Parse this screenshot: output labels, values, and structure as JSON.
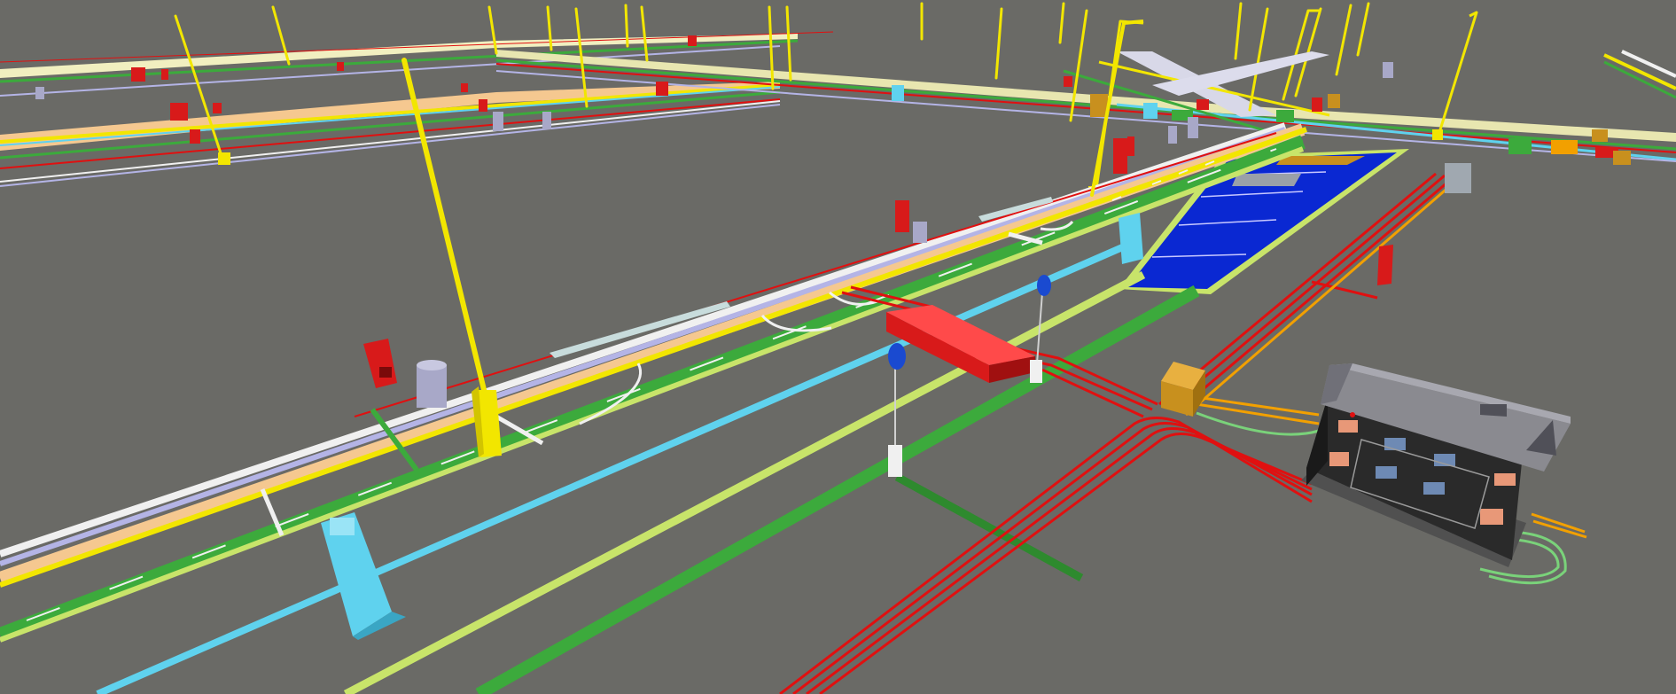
{
  "scene": {
    "background": "#6a6a66",
    "colors": {
      "street_light": "#f2e600",
      "power_cable": "#e01010",
      "telecom_cable": "#f2a000",
      "water_pipe": "#5fd2ee",
      "gas_pipe": "#c8e46a",
      "sewer_pipe": "#3caa3c",
      "district_heating": "#f5c890",
      "lilac_pipe": "#b4b4e6",
      "white_pipe": "#f0f0f0",
      "crosswalk": "#0a28d2",
      "building_wall": "#2a2a2a",
      "building_roof": "#8a8a90",
      "window_frame": "#e89878",
      "window_glass": "#6e8ab4",
      "cabinet": "#c8901e",
      "hydrant": "#d81a1a",
      "manhole": "#a8a8c8"
    },
    "objects": [
      "street-light-poles",
      "underground-pipes",
      "power-cables",
      "crosswalk",
      "transformer-building",
      "distribution-cabinet",
      "road-signs",
      "fire-hydrants",
      "manhole-shafts"
    ]
  }
}
